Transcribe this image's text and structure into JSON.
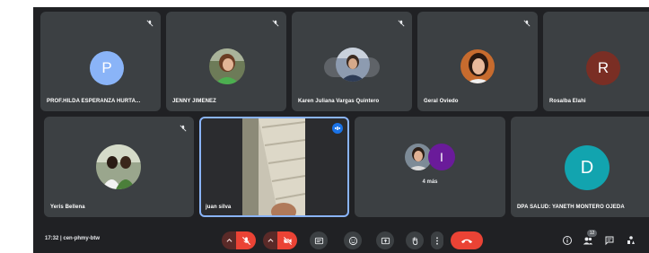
{
  "meeting": {
    "time": "17:32",
    "code": "cen-phmy-btw",
    "more_label": "4 más",
    "participant_count_badge": "12"
  },
  "participants": [
    {
      "name": "PROF.HILDA ESPERANZA HURTA...",
      "initial": "P",
      "color": "#8ab4f8",
      "video": false,
      "muted": true
    },
    {
      "name": "JENNY JIMENEZ",
      "initial": "",
      "video": false,
      "muted": true
    },
    {
      "name": "Karen Juliana Vargas Quintero",
      "initial": "",
      "video": false,
      "muted": true
    },
    {
      "name": "Geral Oviedo",
      "initial": "",
      "video": false,
      "muted": true
    },
    {
      "name": "Rosalba Elahi",
      "initial": "R",
      "color": "#7a2e24",
      "video": false,
      "muted": false
    },
    {
      "name": "Yeris Bellena",
      "initial": "",
      "video": false,
      "muted": true
    },
    {
      "name": "juan silva",
      "initial": "",
      "video": true,
      "speaking": true
    },
    {
      "name": "",
      "initial": "I",
      "color": "#6a1b9a",
      "video": false
    },
    {
      "name": "DPA SALUD: YANETH MONTERO OJEDA",
      "initial": "D",
      "color": "#12a4af",
      "video": false,
      "muted": true
    }
  ],
  "controls": [
    {
      "id": "mic",
      "icon": "mic-off-icon",
      "state": "off",
      "color": "#ea4335"
    },
    {
      "id": "camera",
      "icon": "camera-off-icon",
      "state": "off",
      "color": "#ea4335"
    },
    {
      "id": "captions",
      "icon": "captions-icon"
    },
    {
      "id": "emoji",
      "icon": "emoji-icon"
    },
    {
      "id": "present",
      "icon": "present-screen-icon"
    },
    {
      "id": "hand",
      "icon": "raise-hand-icon"
    },
    {
      "id": "more",
      "icon": "more-options-icon"
    },
    {
      "id": "leave",
      "icon": "hang-up-icon",
      "color": "#ea4335"
    }
  ],
  "right_controls": [
    "info-icon",
    "people-icon",
    "chat-icon",
    "activities-icon"
  ],
  "colors": {
    "background": "#202124",
    "tile": "#3c4043",
    "speaking_border": "#8ab4f8",
    "danger": "#ea4335"
  }
}
